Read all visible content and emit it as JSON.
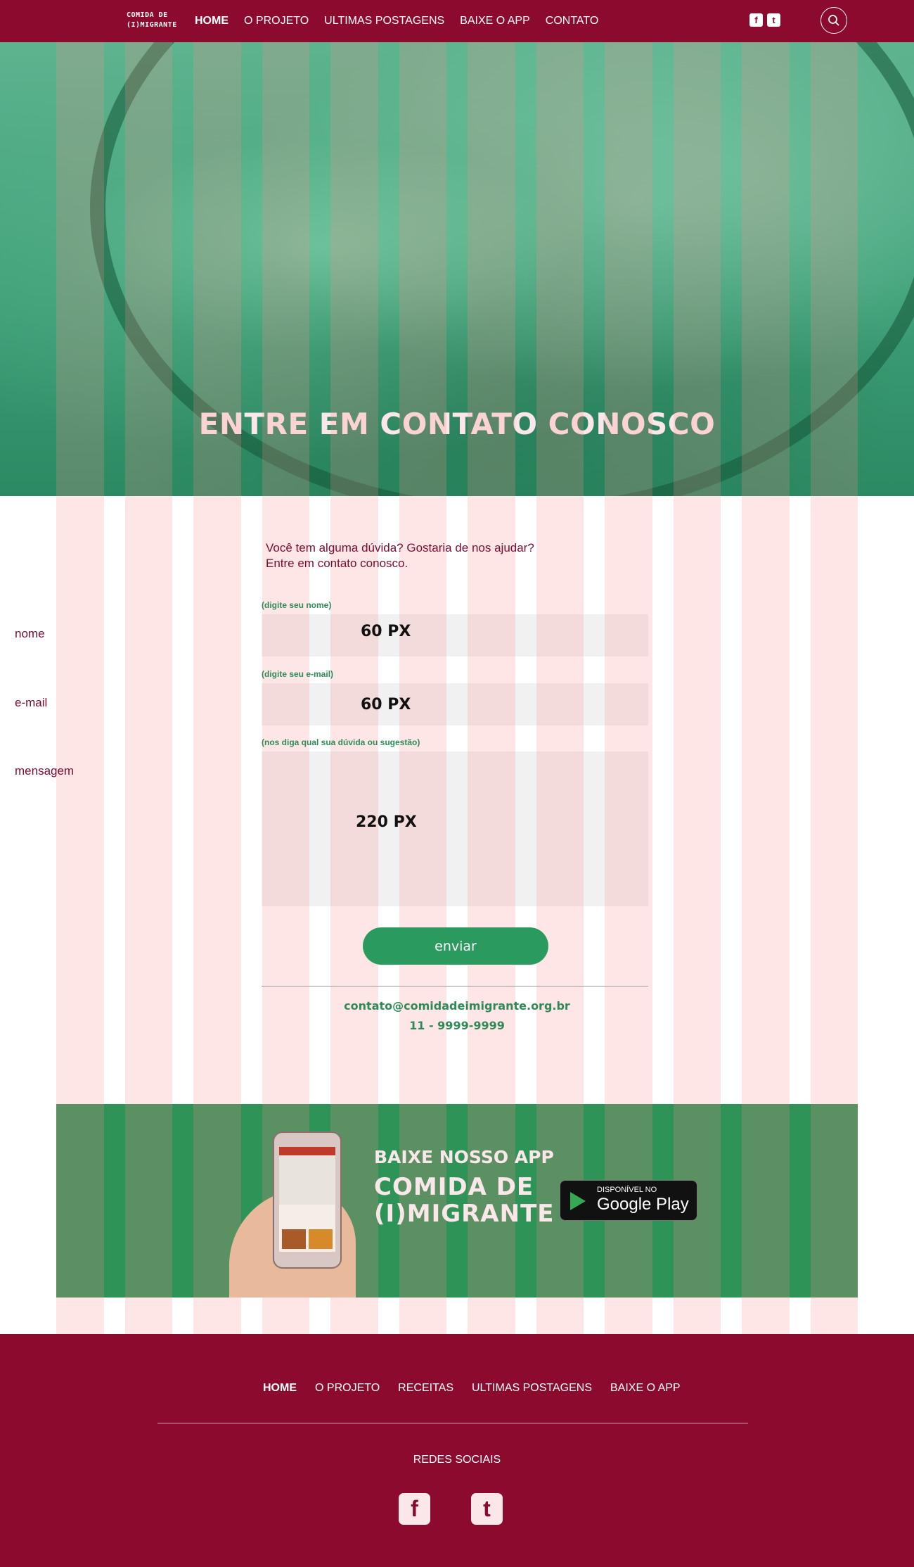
{
  "header": {
    "logo_line1": "COMIDA DE",
    "logo_line2": "(I)MIGRANTE",
    "nav": [
      {
        "label": "HOME",
        "active": true
      },
      {
        "label": "O PROJETO"
      },
      {
        "label": "ULTIMAS POSTAGENS"
      },
      {
        "label": "BAIXE O APP"
      },
      {
        "label": "CONTATO"
      }
    ],
    "icons": [
      "facebook-icon",
      "twitter-icon",
      "search-icon"
    ]
  },
  "hero": {
    "title": "ENTRE EM CONTATO CONOSCO"
  },
  "contact": {
    "intro_line1": "Você tem alguma dúvida? Gostaria de nos ajudar?",
    "intro_line2": "Entre em contato conosco.",
    "name_hint": "(digite seu nome)",
    "name_placeholder": "nome",
    "name_dim": "60 PX",
    "email_hint": "(digite seu e-mail)",
    "email_placeholder": "e-mail",
    "email_dim": "60 PX",
    "message_hint": "(nos diga qual sua dúvida ou sugestão)",
    "message_placeholder": "mensagem",
    "message_dim": "220 PX",
    "send_label": "enviar",
    "email": "contato@comidadeimigrante.org.br",
    "phone": "11 - 9999-9999"
  },
  "app_banner": {
    "heading": "BAIXE NOSSO APP",
    "logo_line1": "COMIDA DE",
    "logo_line2": "(I)MIGRANTE",
    "store_small": "DISPONÍVEL NO",
    "store_big": "Google Play"
  },
  "footer": {
    "nav": [
      {
        "label": "HOME",
        "active": true
      },
      {
        "label": "O PROJETO"
      },
      {
        "label": "RECEITAS"
      },
      {
        "label": "ULTIMAS POSTAGENS"
      },
      {
        "label": "BAIXE O APP"
      }
    ],
    "social_title": "REDES SOCIAIS"
  },
  "colors": {
    "brand": "#8c0a2e",
    "accent_green": "#2e9357",
    "text_wine": "#7a0b30"
  }
}
